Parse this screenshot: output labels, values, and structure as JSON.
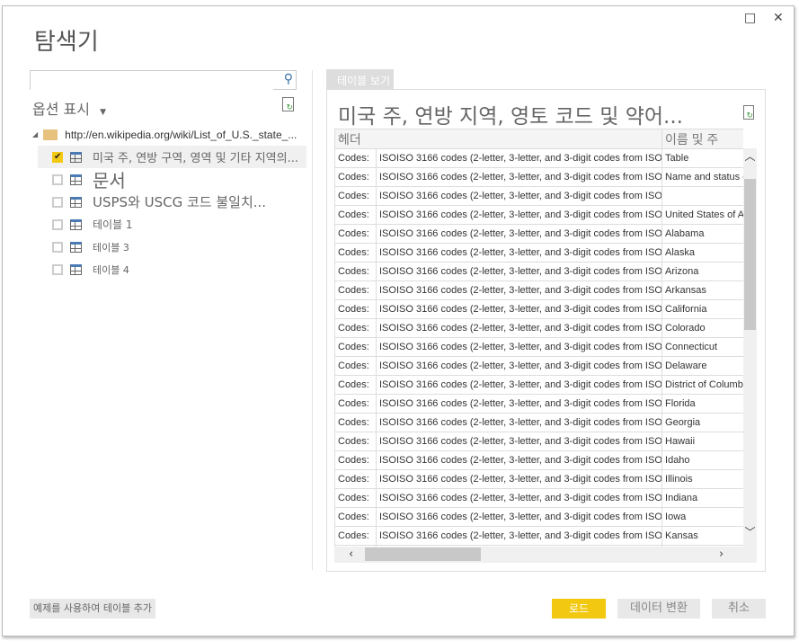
{
  "window": {
    "title": "탐색기",
    "maximize_icon": "□",
    "close_icon": "✕"
  },
  "search": {
    "value": "",
    "placeholder": ""
  },
  "options_label": "옵션 표시",
  "tree": {
    "root": "http://en.wikipedia.org/wiki/List_of_U.S._state_...",
    "items": [
      {
        "label": "미국 주, 연방 구역, 영역 및 기타 지역의...",
        "checked": true
      },
      {
        "label": "문서",
        "checked": false
      },
      {
        "label": "USPS와 USCG 코드 불일치...",
        "checked": false
      },
      {
        "label": "테이블 1",
        "checked": false
      },
      {
        "label": "테이블 3",
        "checked": false
      },
      {
        "label": "테이블 4",
        "checked": false
      }
    ]
  },
  "preview": {
    "tab": "테이블 보기",
    "title": "미국 주, 연방 지역, 영토 코드 및 약어...",
    "columns": [
      "헤더",
      "이름 및 주"
    ],
    "rows": [
      [
        "Codes:",
        "ISOISO 3166 codes (2-letter, 3-letter, and 3-digit codes from ISO",
        "Table"
      ],
      [
        "Codes:",
        "ISOISO 3166 codes (2-letter, 3-letter, and 3-digit codes from ISO",
        "Name and status of"
      ],
      [
        "Codes:",
        "ISOISO 3166 codes (2-letter, 3-letter, and 3-digit codes from ISO",
        ""
      ],
      [
        "Codes:",
        "ISOISO 3166 codes (2-letter, 3-letter, and 3-digit codes from ISO",
        "United States of America"
      ],
      [
        "Codes:",
        "ISOISO 3166 codes (2-letter, 3-letter, and 3-digit codes from ISO",
        "Alabama"
      ],
      [
        "Codes:",
        "ISOISO 3166 codes (2-letter, 3-letter, and 3-digit codes from ISO",
        "Alaska"
      ],
      [
        "Codes:",
        "ISOISO 3166 codes (2-letter, 3-letter, and 3-digit codes from ISO",
        "Arizona"
      ],
      [
        "Codes:",
        "ISOISO 3166 codes (2-letter, 3-letter, and 3-digit codes from ISO",
        "Arkansas"
      ],
      [
        "Codes:",
        "ISOISO 3166 codes (2-letter, 3-letter, and 3-digit codes from ISO",
        "California"
      ],
      [
        "Codes:",
        "ISOISO 3166 codes (2-letter, 3-letter, and 3-digit codes from ISO",
        "Colorado"
      ],
      [
        "Codes:",
        "ISOISO 3166 codes (2-letter, 3-letter, and 3-digit codes from ISO",
        "Connecticut"
      ],
      [
        "Codes:",
        "ISOISO 3166 codes (2-letter, 3-letter, and 3-digit codes from ISO",
        "Delaware"
      ],
      [
        "Codes:",
        "ISOISO 3166 codes (2-letter, 3-letter, and 3-digit codes from ISO",
        "District of Columbia"
      ],
      [
        "Codes:",
        "ISOISO 3166 codes (2-letter, 3-letter, and 3-digit codes from ISO",
        "Florida"
      ],
      [
        "Codes:",
        "ISOISO 3166 codes (2-letter, 3-letter, and 3-digit codes from ISO",
        "Georgia"
      ],
      [
        "Codes:",
        "ISOISO 3166 codes (2-letter, 3-letter, and 3-digit codes from ISO",
        "Hawaii"
      ],
      [
        "Codes:",
        "ISOISO 3166 codes (2-letter, 3-letter, and 3-digit codes from ISO",
        "Idaho"
      ],
      [
        "Codes:",
        "ISOISO 3166 codes (2-letter, 3-letter, and 3-digit codes from ISO",
        "Illinois"
      ],
      [
        "Codes:",
        "ISOISO 3166 codes (2-letter, 3-letter, and 3-digit codes from ISO",
        "Indiana"
      ],
      [
        "Codes:",
        "ISOISO 3166 codes (2-letter, 3-letter, and 3-digit codes from ISO",
        "Iowa"
      ],
      [
        "Codes:",
        "ISOISO 3166 codes (2-letter, 3-letter, and 3-digit codes from ISO",
        "Kansas"
      ],
      [
        "",
        "",
        ""
      ]
    ]
  },
  "footer": {
    "add_from_example": "예제를 사용하여 테이블 추가",
    "load": "로드",
    "transform": "데이터 변환",
    "cancel": "취소"
  },
  "colors": {
    "accent": "#f2c811"
  }
}
